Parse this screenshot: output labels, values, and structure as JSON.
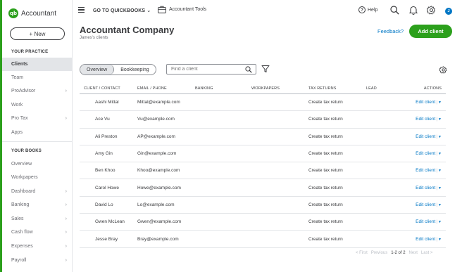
{
  "brand": {
    "logo_text": "qb",
    "name": "Accountant",
    "color": "#2ca01c"
  },
  "sidebar": {
    "new_button": "+ New",
    "your_practice": "YOUR PRACTICE",
    "practice_items": [
      {
        "label": "Clients",
        "active": true,
        "chevron": false
      },
      {
        "label": "Team",
        "active": false,
        "chevron": false
      },
      {
        "label": "ProAdvisor",
        "active": false,
        "chevron": true
      },
      {
        "label": "Work",
        "active": false,
        "chevron": false
      },
      {
        "label": "Pro Tax",
        "active": false,
        "chevron": true
      },
      {
        "label": "Apps",
        "active": false,
        "chevron": false
      }
    ],
    "your_books": "YOUR BOOKS",
    "books_items": [
      {
        "label": "Overview",
        "chevron": false
      },
      {
        "label": "Workpapers",
        "chevron": false
      },
      {
        "label": "Dashboard",
        "chevron": true
      },
      {
        "label": "Banking",
        "chevron": true
      },
      {
        "label": "Sales",
        "chevron": true
      },
      {
        "label": "Cash flow",
        "chevron": true
      },
      {
        "label": "Expenses",
        "chevron": true
      },
      {
        "label": "Payroll",
        "chevron": true
      }
    ],
    "chevron_glyph": "›"
  },
  "topbar": {
    "goto": "GO TO QUICKBOOKS ⌄",
    "tools": "Accountant Tools",
    "help": "Help",
    "help_glyph": "?",
    "avatar": "J"
  },
  "header": {
    "title": "Accountant Company",
    "subtitle": "James's clients",
    "feedback": "Feedback?",
    "add_client": "Add client"
  },
  "toolbar": {
    "tabs": [
      "Overview",
      "Bookkeeping"
    ],
    "search_placeholder": "Find a client"
  },
  "table": {
    "headers": [
      "CLIENT / CONTACT",
      "EMAIL / PHONE",
      "BANKING",
      "WORKPAPERS",
      "TAX RETURNS",
      "LEAD",
      "ACTIONS"
    ],
    "rows": [
      {
        "client": "Aashi Mittal",
        "email": "Mittal@example.com",
        "tax": "Create tax return",
        "action": "Edit client"
      },
      {
        "client": "Ace Vu",
        "email": "Vu@example.com",
        "tax": "Create tax return",
        "action": "Edit client"
      },
      {
        "client": "Ali Preston",
        "email": "AP@example.com",
        "tax": "Create tax return",
        "action": "Edit client"
      },
      {
        "client": "Amy Gin",
        "email": "Gin@example.com",
        "tax": "Create tax return",
        "action": "Edit client"
      },
      {
        "client": "Ben Khoo",
        "email": "Khoo@example.com",
        "tax": "Create tax return",
        "action": "Edit client"
      },
      {
        "client": "Carol Howe",
        "email": "Howe@example.com",
        "tax": "Create tax return",
        "action": "Edit client"
      },
      {
        "client": "David Lo",
        "email": "Lo@example.com",
        "tax": "Create tax return",
        "action": "Edit client"
      },
      {
        "client": "Gwen McLean",
        "email": "Gwen@example.com",
        "tax": "Create tax return",
        "action": "Edit client"
      },
      {
        "client": "Jesse Bray",
        "email": "Bray@example.com",
        "tax": "Create tax return",
        "action": "Edit client"
      }
    ],
    "action_separator": "|",
    "action_caret": "▼"
  },
  "pager": {
    "first": "< First",
    "previous": "Previous",
    "range": "1-2 of 2",
    "next": "Next",
    "last": "Last >"
  },
  "icons": {
    "hamburger": "menu-icon",
    "tools": "briefcase-icon",
    "search": "search-icon",
    "notifications": "bell-icon",
    "settings": "gear-icon",
    "filter": "filter-icon"
  },
  "colors": {
    "accent": "#2ca01c",
    "link": "#0077c5",
    "text": "#393a3d"
  }
}
